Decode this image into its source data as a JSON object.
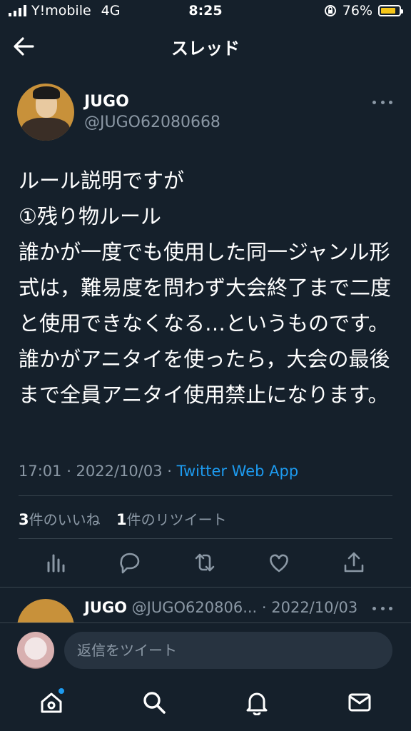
{
  "status_bar": {
    "carrier": "Y!mobile",
    "network": "4G",
    "time": "8:25",
    "battery": "76%",
    "battery_fraction": 0.76
  },
  "header": {
    "title": "スレッド"
  },
  "tweet": {
    "author_name": "JUGO",
    "author_handle": "@JUGO62080668",
    "text": "ルール説明ですが\n①残り物ルール\n誰かが一度でも使用した同一ジャンル形式は，難易度を問わず大会終了まで二度と使用できなくなる…というものです。誰かがアニタイを使ったら，大会の最後まで全員アニタイ使用禁止になります。",
    "timestamp": "17:01 · 2022/10/03 · ",
    "source_app": "Twitter Web App",
    "likes_count": "3",
    "likes_label": "件のいいね",
    "retweets_count": "1",
    "retweets_label": "件のリツイート"
  },
  "reply": {
    "author_name": "JUGO",
    "author_handle_date": "@JUGO620806... · 2022/10/03"
  },
  "composer": {
    "placeholder": "返信をツイート"
  },
  "colors": {
    "background": "#15202b",
    "accent": "#1d9bf0",
    "secondary_text": "#8b98a5",
    "divider": "#38444d"
  },
  "icons": [
    "back-arrow-icon",
    "more-icon",
    "analytics-icon",
    "reply-icon",
    "retweet-icon",
    "like-icon",
    "share-icon",
    "home-icon",
    "search-icon",
    "notifications-icon",
    "messages-icon"
  ]
}
